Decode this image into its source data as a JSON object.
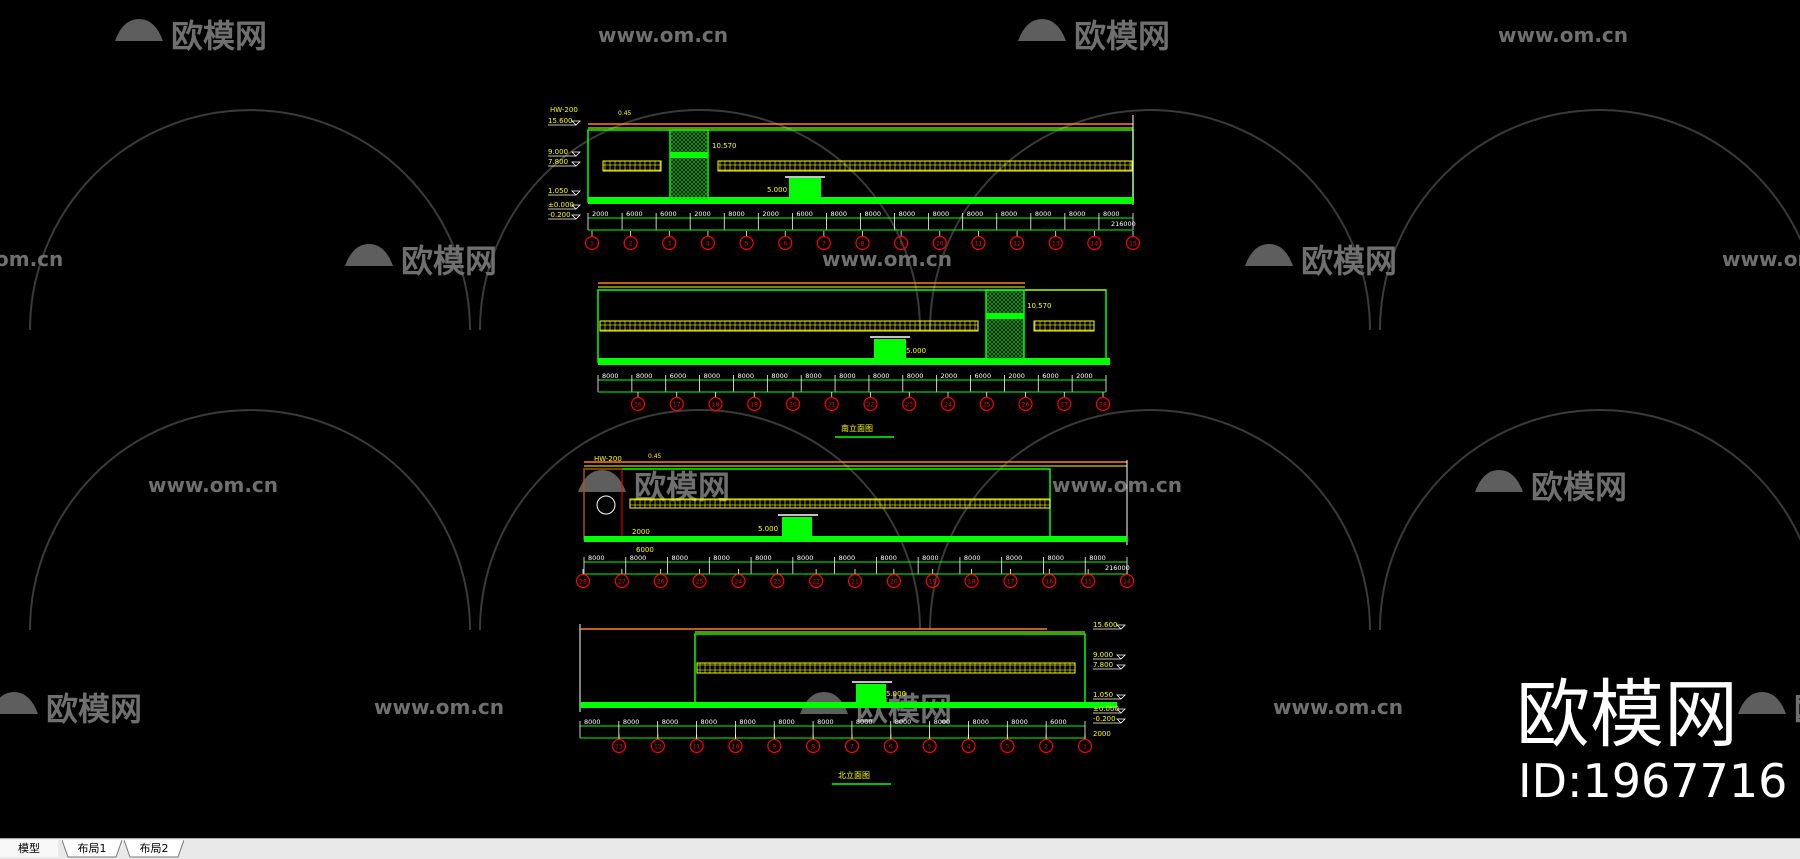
{
  "watermark": {
    "brand": "欧模网",
    "url": "www.om.cn",
    "url_partial": "om.cn",
    "brand_partial_left": "欧模网",
    "brand_partial_right": "欧",
    "big_brand": "欧模网",
    "id_label": "ID:1967716"
  },
  "drawing": {
    "view1": {
      "elev_labels": [
        "15.600",
        "9.000",
        "7.800",
        "1.050",
        "±0.000",
        "-0.200"
      ],
      "hw_label": "HW-200",
      "level_mark": "10.570",
      "level_mark_small": "5.000",
      "top_tag": "0.45",
      "dims": [
        "2000",
        "6000",
        "6000",
        "2000",
        "8000",
        "2000",
        "6000",
        "8000",
        "8000",
        "8000",
        "8000",
        "8000",
        "8000",
        "8000",
        "8000",
        "8000"
      ],
      "total": "216000",
      "axes": [
        "1",
        "2",
        "3",
        "4",
        "5",
        "6",
        "7",
        "8",
        "9",
        "10",
        "11",
        "12",
        "13",
        "14",
        "15"
      ]
    },
    "view2": {
      "level_mark": "10.570",
      "level_mark_small": "5.000",
      "dims": [
        "8000",
        "8000",
        "6000",
        "8000",
        "8000",
        "8000",
        "8000",
        "8000",
        "8000",
        "8000",
        "2000",
        "6000",
        "2000",
        "6000",
        "2000"
      ],
      "axes": [
        "16",
        "17",
        "18",
        "19",
        "20",
        "21",
        "22",
        "23",
        "24",
        "25",
        "26",
        "27",
        "28"
      ],
      "title": "南立面图"
    },
    "view3": {
      "hw_label": "HW-200",
      "top_tag": "0.45",
      "level_mark_small": "5.000",
      "side_dims": [
        "2000",
        "6000"
      ],
      "dims": [
        "8000",
        "8000",
        "8000",
        "8000",
        "8000",
        "8000",
        "8000",
        "8000",
        "8000",
        "8000",
        "8000",
        "8000",
        "8000"
      ],
      "total": "216000",
      "axes": [
        "28",
        "27",
        "26",
        "25",
        "24",
        "23",
        "22",
        "21",
        "20",
        "19",
        "18",
        "17",
        "16",
        "15",
        "14"
      ]
    },
    "view4": {
      "elev_labels": [
        "15.600",
        "9.000",
        "7.800",
        "1.050",
        "±0.000",
        "-0.200"
      ],
      "level_mark_small": "5.000",
      "dims": [
        "8000",
        "8000",
        "8000",
        "8000",
        "8000",
        "8000",
        "8000",
        "8000",
        "8000",
        "8000",
        "8000",
        "8000",
        "6000"
      ],
      "side_dim": "2000",
      "axes": [
        "13",
        "12",
        "11",
        "10",
        "9",
        "8",
        "7",
        "6",
        "5",
        "4",
        "3",
        "2",
        "1"
      ],
      "title": "北立面图"
    }
  },
  "tabs": [
    {
      "label": "模型",
      "active": true
    },
    {
      "label": "布局1",
      "active": false
    },
    {
      "label": "布局2",
      "active": false
    }
  ],
  "colors": {
    "background": "#000000",
    "cad_green": "#00ff00",
    "cad_yellow": "#ffff00",
    "cad_red": "#ff0000",
    "cad_orange": "#ff7f27",
    "watermark_gray": "#6f6f6f"
  }
}
